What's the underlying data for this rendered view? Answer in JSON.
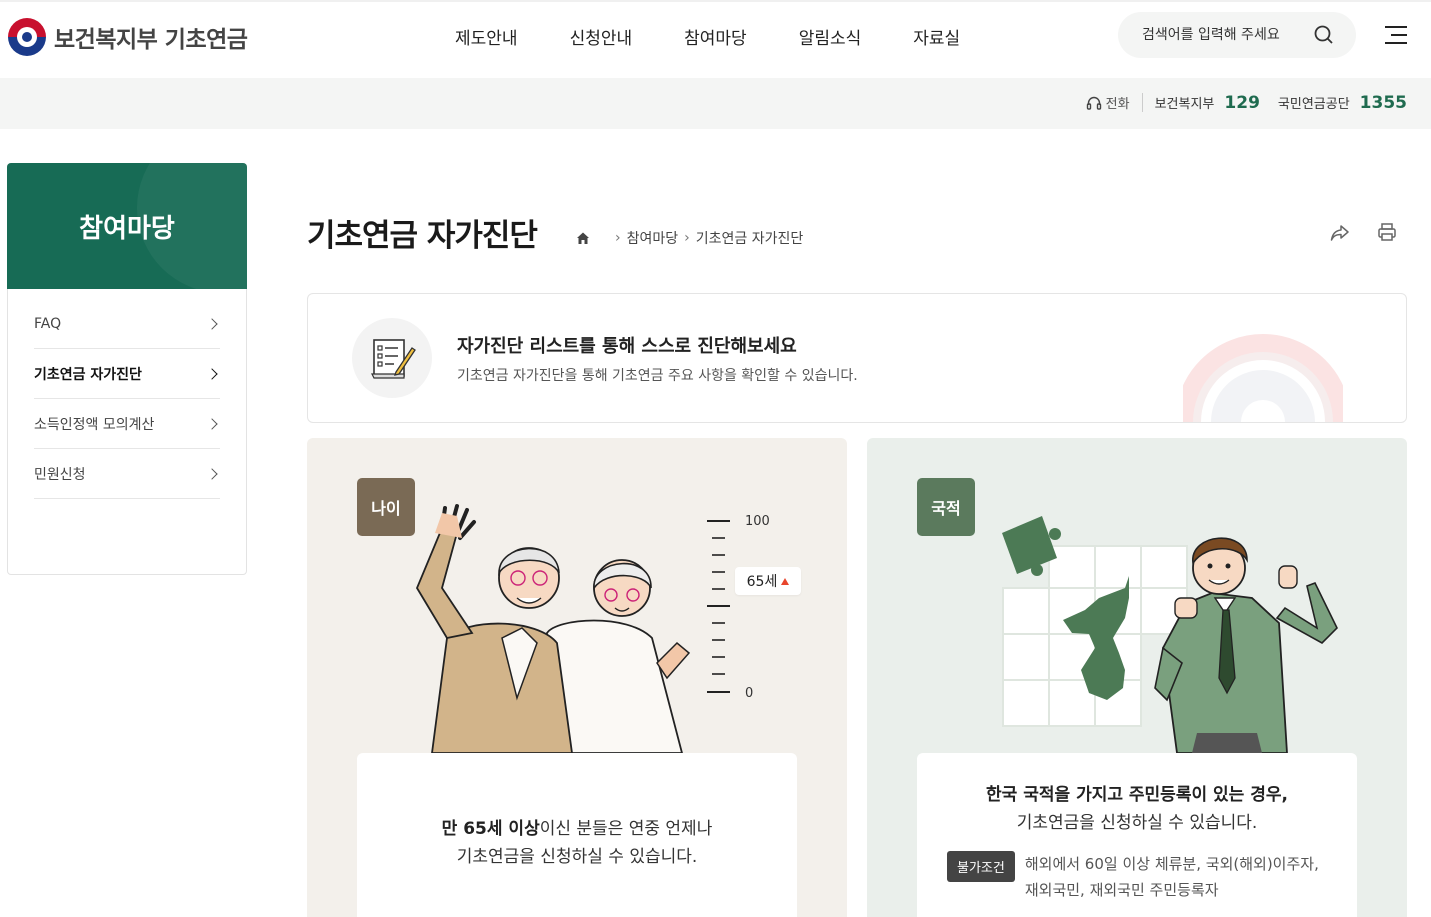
{
  "header": {
    "logo_text": "보건복지부 기초연금",
    "nav": [
      "제도안내",
      "신청안내",
      "참여마당",
      "알림소식",
      "자료실"
    ],
    "search_placeholder": "검색어를 입력해 주세요"
  },
  "contact": {
    "label": "전화",
    "org1": "보건복지부",
    "num1": "129",
    "org2": "국민연금공단",
    "num2": "1355"
  },
  "sidebar": {
    "title": "참여마당",
    "items": [
      {
        "label": "FAQ"
      },
      {
        "label": "기초연금 자가진단"
      },
      {
        "label": "소득인정액 모의계산"
      },
      {
        "label": "민원신청"
      }
    ]
  },
  "page": {
    "title": "기초연금 자가진단",
    "breadcrumb": [
      "참여마당",
      "기초연금 자가진단"
    ]
  },
  "intro": {
    "title": "자가진단 리스트를 통해 스스로 진단해보세요",
    "desc": "기초연금 자가진단을 통해 기초연금 주요 사항을 확인할 수 있습니다."
  },
  "cards": {
    "age": {
      "badge": "나이",
      "scale_top": "100",
      "scale_bottom": "0",
      "age_tag": "65세",
      "text_strong": "만 65세 이상",
      "text_rest": "이신 분들은 연중 언제나",
      "text_line2": "기초연금을 신청하실 수 있습니다."
    },
    "nationality": {
      "badge": "국적",
      "text_line1": "한국 국적을 가지고 주민등록이 있는 경우,",
      "text_line2": "기초연금을 신청하실 수 있습니다.",
      "cond_badge": "불가조건",
      "cond_line1": "해외에서 60일 이상 체류분, 국외(해외)이주자,",
      "cond_line2": "재외국민, 재외국민 주민등록자"
    }
  },
  "colors": {
    "brand_green": "#176b55",
    "accent_number": "#1f6b4f",
    "age_badge": "#7a6a55",
    "nat_badge": "#5b7a5d"
  }
}
